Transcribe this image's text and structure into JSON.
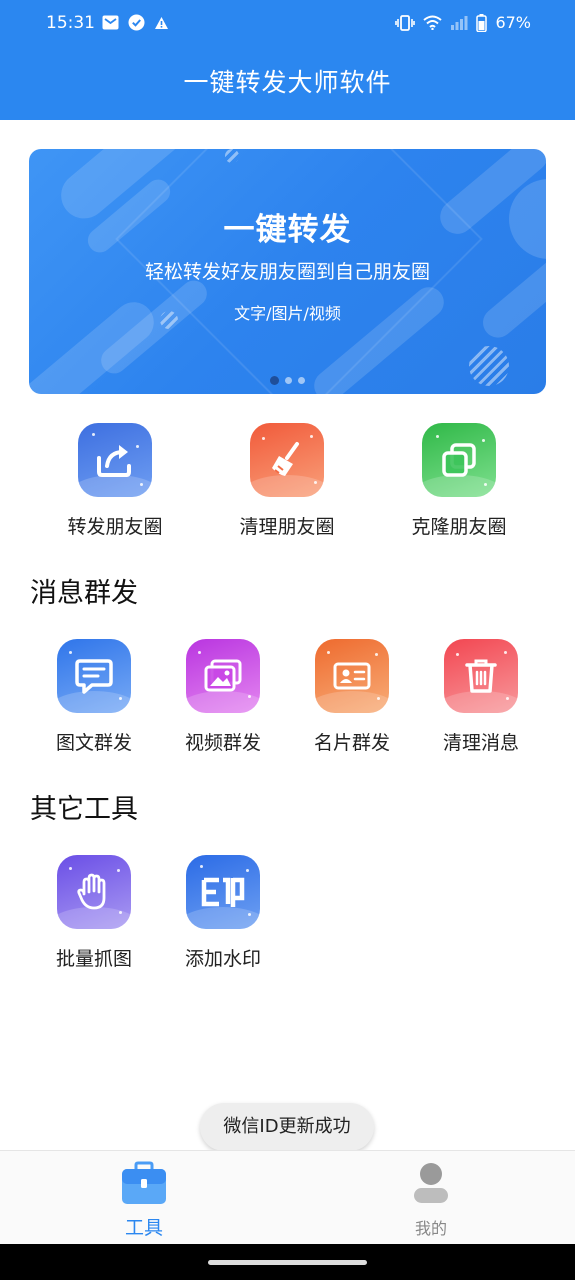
{
  "status_bar": {
    "time": "15:31",
    "battery": "67%",
    "icons": [
      "mail-icon",
      "check-circle-icon",
      "warning-icon",
      "vibrate-icon",
      "wifi-icon",
      "signal-icon",
      "battery-icon"
    ]
  },
  "header": {
    "title": "一键转发大师软件"
  },
  "banner": {
    "title": "一键转发",
    "subtitle": "轻松转发好友朋友圈到自己朋友圈",
    "tagline": "文字/图片/视频",
    "slides": 3,
    "active_slide": 1
  },
  "main_tools": [
    {
      "label": "转发朋友圈",
      "icon": "share-forward-icon",
      "color": "#4f80ea"
    },
    {
      "label": "清理朋友圈",
      "icon": "broom-icon",
      "color": "#f26c45"
    },
    {
      "label": "克隆朋友圈",
      "icon": "copy-icon",
      "color": "#3ec45a"
    }
  ],
  "messaging": {
    "title": "消息群发",
    "items": [
      {
        "label": "图文群发",
        "icon": "chat-icon",
        "color": "#3f86ef"
      },
      {
        "label": "视频群发",
        "icon": "image-gallery-icon",
        "color": "#c946e6"
      },
      {
        "label": "名片群发",
        "icon": "business-card-icon",
        "color": "#f07b3c"
      },
      {
        "label": "清理消息",
        "icon": "trash-icon",
        "color": "#f25d64"
      }
    ]
  },
  "other_tools": {
    "title": "其它工具",
    "items": [
      {
        "label": "批量抓图",
        "icon": "hand-grab-icon",
        "color": "#7860e8"
      },
      {
        "label": "添加水印",
        "icon": "stamp-icon",
        "color": "#3a7de9"
      }
    ]
  },
  "toast": {
    "text": "微信ID更新成功"
  },
  "bottom_nav": [
    {
      "label": "工具",
      "icon": "toolbox-icon",
      "active": true,
      "color": "#2b87f0"
    },
    {
      "label": "我的",
      "icon": "user-icon",
      "active": false,
      "color": "#888888"
    }
  ]
}
